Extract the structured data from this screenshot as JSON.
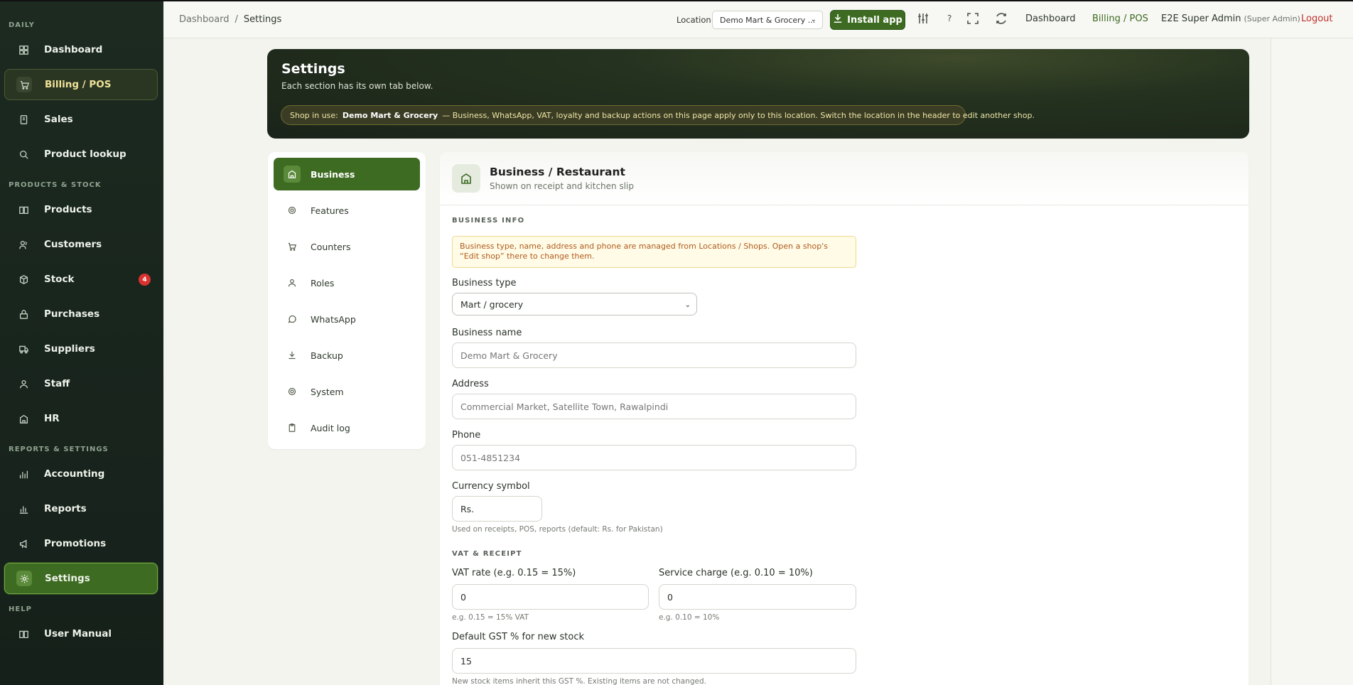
{
  "sidebar": {
    "sections": {
      "daily": "DAILY",
      "products": "PRODUCTS & STOCK",
      "reports": "REPORTS & SETTINGS",
      "help": "HELP"
    },
    "items": {
      "dashboard": "Dashboard",
      "billing": "Billing / POS",
      "sales": "Sales",
      "lookup": "Product lookup",
      "products": "Products",
      "customers": "Customers",
      "stock": "Stock",
      "stock_badge": "4",
      "purchases": "Purchases",
      "suppliers": "Suppliers",
      "staff": "Staff",
      "hr": "HR",
      "accounting": "Accounting",
      "reports": "Reports",
      "promotions": "Promotions",
      "settings": "Settings",
      "manual": "User Manual"
    }
  },
  "header": {
    "breadcrumb_root": "Dashboard",
    "breadcrumb_sep": "/",
    "breadcrumb_current": "Settings",
    "location_label": "Location",
    "location_value": "Demo Mart & Grocery ...",
    "install_label": "Install app",
    "help_glyph": "?",
    "nav_dashboard": "Dashboard",
    "nav_billing": "Billing / POS",
    "user_name": "E2E Super Admin",
    "user_role": "(Super Admin)",
    "logout": "Logout"
  },
  "hero": {
    "title": "Settings",
    "subtitle": "Each section has its own tab below.",
    "shop_label": "Shop in use:",
    "shop_name": "Demo Mart & Grocery",
    "shop_note": "— Business, WhatsApp, VAT, loyalty and backup actions on this page apply only to this location. Switch the location in the header to edit another shop."
  },
  "tabs": {
    "business": "Business",
    "features": "Features",
    "counters": "Counters",
    "roles": "Roles",
    "whatsapp": "WhatsApp",
    "backup": "Backup",
    "system": "System",
    "audit": "Audit log"
  },
  "card": {
    "title": "Business / Restaurant",
    "description": "Shown on receipt and kitchen slip",
    "section_info": "BUSINESS INFO",
    "notice": "Business type, name, address and phone are managed from Locations / Shops. Open a shop's “Edit shop” there to change them.",
    "business_type_label": "Business type",
    "business_type_value": "Mart / grocery",
    "business_name_label": "Business name",
    "business_name_value": "Demo Mart & Grocery",
    "address_label": "Address",
    "address_value": "Commercial Market, Satellite Town, Rawalpindi",
    "phone_label": "Phone",
    "phone_value": "051-4851234",
    "currency_label": "Currency symbol",
    "currency_value": "Rs.",
    "currency_hint": "Used on receipts, POS, reports (default: Rs. for Pakistan)",
    "section_vat": "VAT & RECEIPT",
    "vat_label": "VAT rate (e.g. 0.15 = 15%)",
    "vat_value": "0",
    "vat_hint": "e.g. 0.15 = 15% VAT",
    "service_label": "Service charge (e.g. 0.10 = 10%)",
    "service_value": "0",
    "service_hint": "e.g. 0.10 = 10%",
    "gst_label": "Default GST % for new stock",
    "gst_value": "15",
    "gst_hint": "New stock items inherit this GST %. Existing items are not changed."
  }
}
